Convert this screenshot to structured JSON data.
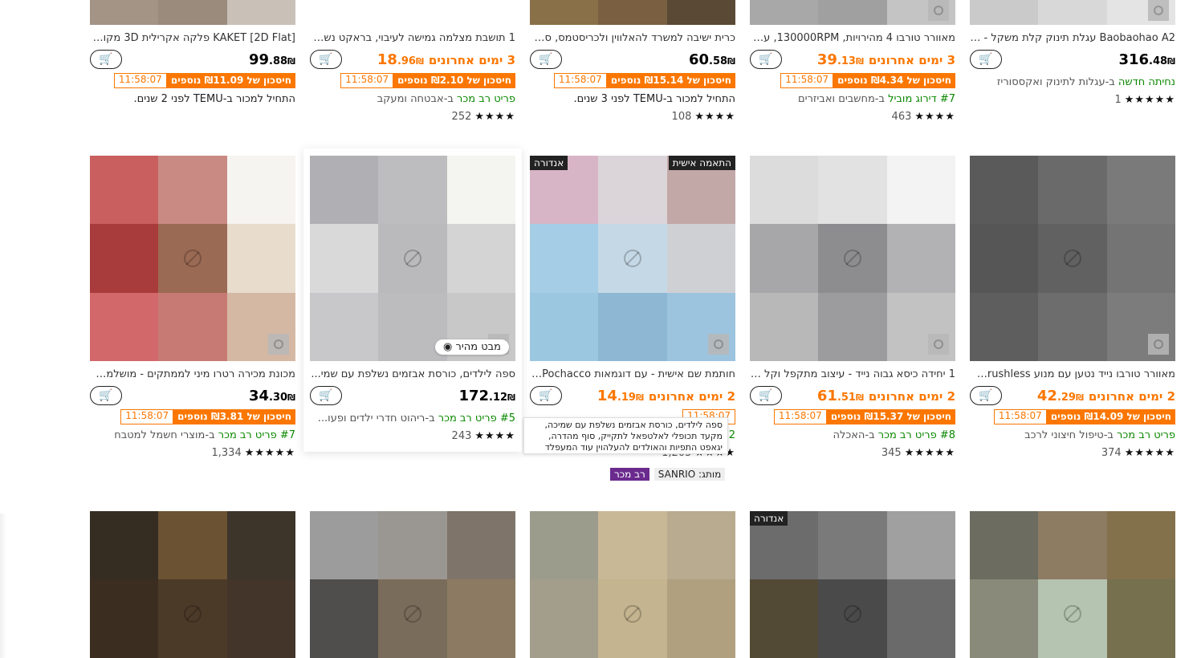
{
  "currency": "₪",
  "icons": {
    "cart": "add-to-cart-icon",
    "eye": "eye-icon",
    "star": "star-icon",
    "no_image": "no-image-icon",
    "mystery": "gear-placeholder-icon"
  },
  "colors": {
    "accent": "#fb7701",
    "green": "#0a8800",
    "purple": "#6b2a8e"
  },
  "row1": [
    {
      "title": "KAKET [2D Flat] פלקה אקרילית 3D מקורבת...",
      "price_int": "99",
      "price_dec": ".88",
      "last_days": "",
      "save_text": "חיסכון של ₪11.09 נוספים",
      "timer": "11:58:07",
      "meta_green": "",
      "meta_rest": "",
      "meta_black": "התחיל למכור ב-TEMU לפני 2 שנים.",
      "stars": "",
      "count": ""
    },
    {
      "title": "1 תושבת מצלמה גמישה לעיבוי, בראקט נשל...",
      "price_int": "18",
      "price_dec": ".96",
      "last_days": "3 ימים אחרונים",
      "save_text": "חיסכון של ₪2.10 נוספים",
      "timer": "11:58:07",
      "meta_green": "פריט רב מכר",
      "meta_rest": " ב-אבטחה ומעקב",
      "meta_black": "",
      "stars": "★★★★",
      "count": "252"
    },
    {
      "title": "כרית ישיבה למשרד להאלווין ולכריסטמס, ספ...",
      "price_int": "60",
      "price_dec": ".58",
      "last_days": "",
      "save_text": "חיסכון של ₪15.14 נוספים",
      "timer": "11:58:07",
      "meta_green": "",
      "meta_rest": "",
      "meta_black": "התחיל למכור ב-TEMU לפני 3 שנים.",
      "stars": "★★★★",
      "count": "108"
    },
    {
      "title": "מאוורר טורבו 4 מהירויות, 130000RPM, עם 5...",
      "price_int": "39",
      "price_dec": ".13",
      "last_days": "3 ימים אחרונים",
      "save_text": "חיסכון של ₪4.34 נוספים",
      "timer": "11:58:07",
      "meta_green": "#7 דירוג מוביל",
      "meta_rest": " ב-מחשבים ואביזרים",
      "meta_black": "",
      "stars": "★★★★",
      "count": "463"
    },
    {
      "title": "Baobaohao A2 עגלת תינוק קלת משקל - עג...",
      "price_int": "316",
      "price_dec": ".48",
      "last_days": "",
      "save_text": "",
      "timer": "",
      "meta_green": "נחיתה חדשה",
      "meta_rest": " ב-עגלות לתינוק ואקססוריז",
      "meta_black": "",
      "stars": "★★★★★",
      "count": "1"
    }
  ],
  "row2": [
    {
      "title": "מכונת מכירה רטרו מיני לממתקים - מושלמת...",
      "price_int": "34",
      "price_dec": ".30",
      "last_days": "",
      "save_text": "חיסכון של ₪3.81 נוספים",
      "timer": "11:58:07",
      "meta_green": "#7 פריט רב מכר",
      "meta_rest": " ב-מוצרי חשמל למטבח",
      "stars": "★★★★★",
      "count": "1,334",
      "badge": "",
      "quick": ""
    },
    {
      "title": "ספה לילדים, כורסת אבזמים נשלפת עם שמי...",
      "price_int": "172",
      "price_dec": ".12",
      "last_days": "",
      "save_text": "",
      "timer": "",
      "meta_green": "#5 פריט רב מכר",
      "meta_rest": " ב-ריהוט חדרי ילדים ופעו...",
      "stars": "★★★★",
      "count": "243",
      "badge": "",
      "quick": "מבט מהיר"
    },
    {
      "title": "חותמת שם אישית - עם דוגמאות Pochacco ...",
      "price_int": "14",
      "price_dec": ".19",
      "last_days": "2 ימים אחרונים",
      "save_text": "",
      "timer": "11:58:07",
      "meta_green": "#2",
      "meta_rest": "",
      "stars": "★★★★",
      "count": "1,205",
      "badge": "התאמה אישית",
      "badge2": "אנדורה",
      "quick": ""
    },
    {
      "title": "1 יחידה כיסא גבוה נייד - עיצוב מתקפל וקל מ...",
      "price_int": "61",
      "price_dec": ".51",
      "last_days": "2 ימים אחרונים",
      "save_text": "חיסכון של ₪15.37 נוספים",
      "timer": "11:58:07",
      "meta_green": "#8 פריט רב מכר",
      "meta_rest": " ב-האכלה",
      "stars": "★★★★★",
      "count": "345",
      "badge": "",
      "quick": ""
    },
    {
      "title": "מאוורר טורבו נייד נטען עם מנוע Brushless, ט...",
      "price_int": "42",
      "price_dec": ".29",
      "last_days": "2 ימים אחרונים",
      "save_text": "חיסכון של ₪14.09 נוספים",
      "timer": "11:58:07",
      "meta_green": "פריט רב מכר",
      "meta_rest": " ב-טיפול חיצוני לרכב",
      "stars": "★★★★★",
      "count": "374",
      "badge": "",
      "quick": ""
    }
  ],
  "tooltip": "ספה לילדים, כורסת אבזמים נשלפת עם שמיכה, מקעד תכופלי לאלטפאל לתקייק, סוף מהדרה, יגאפט התפיות והאולדים להעלהוין עוד המעפלד",
  "tags": {
    "best_seller": "רב מכר",
    "brand": "מותג: SANRIO"
  },
  "row3_badge": "אנדורה"
}
